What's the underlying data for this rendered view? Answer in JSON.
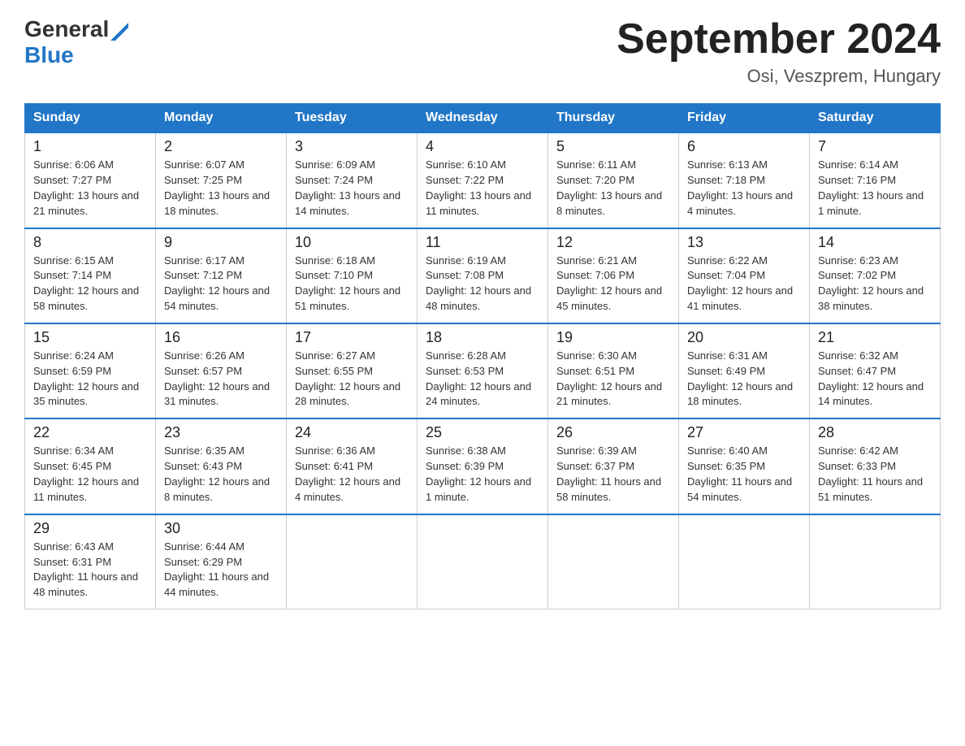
{
  "header": {
    "logo_general": "General",
    "logo_blue": "Blue",
    "month_title": "September 2024",
    "location": "Osi, Veszprem, Hungary"
  },
  "days_of_week": [
    "Sunday",
    "Monday",
    "Tuesday",
    "Wednesday",
    "Thursday",
    "Friday",
    "Saturday"
  ],
  "weeks": [
    [
      {
        "day": "1",
        "sunrise": "Sunrise: 6:06 AM",
        "sunset": "Sunset: 7:27 PM",
        "daylight": "Daylight: 13 hours and 21 minutes."
      },
      {
        "day": "2",
        "sunrise": "Sunrise: 6:07 AM",
        "sunset": "Sunset: 7:25 PM",
        "daylight": "Daylight: 13 hours and 18 minutes."
      },
      {
        "day": "3",
        "sunrise": "Sunrise: 6:09 AM",
        "sunset": "Sunset: 7:24 PM",
        "daylight": "Daylight: 13 hours and 14 minutes."
      },
      {
        "day": "4",
        "sunrise": "Sunrise: 6:10 AM",
        "sunset": "Sunset: 7:22 PM",
        "daylight": "Daylight: 13 hours and 11 minutes."
      },
      {
        "day": "5",
        "sunrise": "Sunrise: 6:11 AM",
        "sunset": "Sunset: 7:20 PM",
        "daylight": "Daylight: 13 hours and 8 minutes."
      },
      {
        "day": "6",
        "sunrise": "Sunrise: 6:13 AM",
        "sunset": "Sunset: 7:18 PM",
        "daylight": "Daylight: 13 hours and 4 minutes."
      },
      {
        "day": "7",
        "sunrise": "Sunrise: 6:14 AM",
        "sunset": "Sunset: 7:16 PM",
        "daylight": "Daylight: 13 hours and 1 minute."
      }
    ],
    [
      {
        "day": "8",
        "sunrise": "Sunrise: 6:15 AM",
        "sunset": "Sunset: 7:14 PM",
        "daylight": "Daylight: 12 hours and 58 minutes."
      },
      {
        "day": "9",
        "sunrise": "Sunrise: 6:17 AM",
        "sunset": "Sunset: 7:12 PM",
        "daylight": "Daylight: 12 hours and 54 minutes."
      },
      {
        "day": "10",
        "sunrise": "Sunrise: 6:18 AM",
        "sunset": "Sunset: 7:10 PM",
        "daylight": "Daylight: 12 hours and 51 minutes."
      },
      {
        "day": "11",
        "sunrise": "Sunrise: 6:19 AM",
        "sunset": "Sunset: 7:08 PM",
        "daylight": "Daylight: 12 hours and 48 minutes."
      },
      {
        "day": "12",
        "sunrise": "Sunrise: 6:21 AM",
        "sunset": "Sunset: 7:06 PM",
        "daylight": "Daylight: 12 hours and 45 minutes."
      },
      {
        "day": "13",
        "sunrise": "Sunrise: 6:22 AM",
        "sunset": "Sunset: 7:04 PM",
        "daylight": "Daylight: 12 hours and 41 minutes."
      },
      {
        "day": "14",
        "sunrise": "Sunrise: 6:23 AM",
        "sunset": "Sunset: 7:02 PM",
        "daylight": "Daylight: 12 hours and 38 minutes."
      }
    ],
    [
      {
        "day": "15",
        "sunrise": "Sunrise: 6:24 AM",
        "sunset": "Sunset: 6:59 PM",
        "daylight": "Daylight: 12 hours and 35 minutes."
      },
      {
        "day": "16",
        "sunrise": "Sunrise: 6:26 AM",
        "sunset": "Sunset: 6:57 PM",
        "daylight": "Daylight: 12 hours and 31 minutes."
      },
      {
        "day": "17",
        "sunrise": "Sunrise: 6:27 AM",
        "sunset": "Sunset: 6:55 PM",
        "daylight": "Daylight: 12 hours and 28 minutes."
      },
      {
        "day": "18",
        "sunrise": "Sunrise: 6:28 AM",
        "sunset": "Sunset: 6:53 PM",
        "daylight": "Daylight: 12 hours and 24 minutes."
      },
      {
        "day": "19",
        "sunrise": "Sunrise: 6:30 AM",
        "sunset": "Sunset: 6:51 PM",
        "daylight": "Daylight: 12 hours and 21 minutes."
      },
      {
        "day": "20",
        "sunrise": "Sunrise: 6:31 AM",
        "sunset": "Sunset: 6:49 PM",
        "daylight": "Daylight: 12 hours and 18 minutes."
      },
      {
        "day": "21",
        "sunrise": "Sunrise: 6:32 AM",
        "sunset": "Sunset: 6:47 PM",
        "daylight": "Daylight: 12 hours and 14 minutes."
      }
    ],
    [
      {
        "day": "22",
        "sunrise": "Sunrise: 6:34 AM",
        "sunset": "Sunset: 6:45 PM",
        "daylight": "Daylight: 12 hours and 11 minutes."
      },
      {
        "day": "23",
        "sunrise": "Sunrise: 6:35 AM",
        "sunset": "Sunset: 6:43 PM",
        "daylight": "Daylight: 12 hours and 8 minutes."
      },
      {
        "day": "24",
        "sunrise": "Sunrise: 6:36 AM",
        "sunset": "Sunset: 6:41 PM",
        "daylight": "Daylight: 12 hours and 4 minutes."
      },
      {
        "day": "25",
        "sunrise": "Sunrise: 6:38 AM",
        "sunset": "Sunset: 6:39 PM",
        "daylight": "Daylight: 12 hours and 1 minute."
      },
      {
        "day": "26",
        "sunrise": "Sunrise: 6:39 AM",
        "sunset": "Sunset: 6:37 PM",
        "daylight": "Daylight: 11 hours and 58 minutes."
      },
      {
        "day": "27",
        "sunrise": "Sunrise: 6:40 AM",
        "sunset": "Sunset: 6:35 PM",
        "daylight": "Daylight: 11 hours and 54 minutes."
      },
      {
        "day": "28",
        "sunrise": "Sunrise: 6:42 AM",
        "sunset": "Sunset: 6:33 PM",
        "daylight": "Daylight: 11 hours and 51 minutes."
      }
    ],
    [
      {
        "day": "29",
        "sunrise": "Sunrise: 6:43 AM",
        "sunset": "Sunset: 6:31 PM",
        "daylight": "Daylight: 11 hours and 48 minutes."
      },
      {
        "day": "30",
        "sunrise": "Sunrise: 6:44 AM",
        "sunset": "Sunset: 6:29 PM",
        "daylight": "Daylight: 11 hours and 44 minutes."
      },
      {
        "day": "",
        "sunrise": "",
        "sunset": "",
        "daylight": ""
      },
      {
        "day": "",
        "sunrise": "",
        "sunset": "",
        "daylight": ""
      },
      {
        "day": "",
        "sunrise": "",
        "sunset": "",
        "daylight": ""
      },
      {
        "day": "",
        "sunrise": "",
        "sunset": "",
        "daylight": ""
      },
      {
        "day": "",
        "sunrise": "",
        "sunset": "",
        "daylight": ""
      }
    ]
  ]
}
